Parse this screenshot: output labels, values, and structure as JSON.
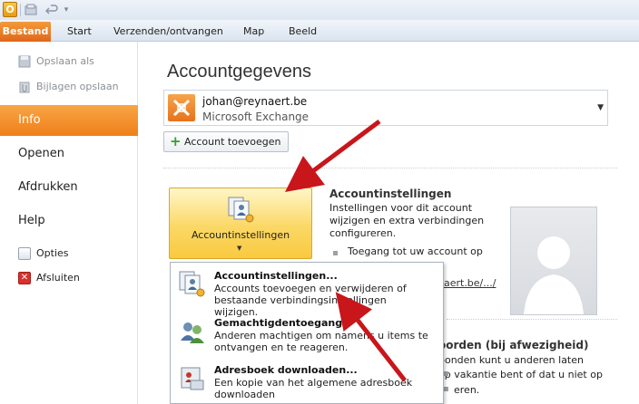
{
  "titlebar": {
    "app_letter": "O"
  },
  "ribbon": {
    "file_tab": "Bestand",
    "tabs": [
      "Start",
      "Verzenden/ontvangen",
      "Map",
      "Beeld"
    ]
  },
  "nav": {
    "save_as": "Opslaan als",
    "save_attachments": "Bijlagen opslaan",
    "info": "Info",
    "open": "Openen",
    "print": "Afdrukken",
    "help": "Help",
    "options": "Opties",
    "exit": "Afsluiten"
  },
  "main": {
    "title": "Accountgegevens",
    "account": {
      "email": "johan@reynaert.be",
      "type": "Microsoft Exchange"
    },
    "add_account": "Account toevoegen",
    "settings_button": "Accountinstellingen",
    "settings_section": {
      "title": "Accountinstellingen",
      "desc_lines": [
        "Instellingen voor dit account",
        "wijzigen en extra verbindingen",
        "configureren."
      ],
      "bullet": "Toegang tot uw account op",
      "link_partial": "naert.be/.../"
    },
    "ooo_section": {
      "title": "oorden (bij afwezigheid)",
      "line1": "bonden kunt u anderen laten",
      "line2": "op vakantie bent of dat u niet op",
      "line3": "eren."
    }
  },
  "menu": {
    "items": [
      {
        "title": "Accountinstellingen...",
        "desc1": "Accounts toevoegen en verwijderen of",
        "desc2": "bestaande verbindingsinstellingen wijzigen."
      },
      {
        "title": "Gemachtigdentoegang",
        "desc1": "Anderen machtigen om namens u items te",
        "desc2": "ontvangen en te reageren."
      },
      {
        "title": "Adresboek downloaden...",
        "desc1": "Een kopie van het algemene adresboek",
        "desc2": "downloaden"
      }
    ]
  },
  "colors": {
    "accent_orange": "#f29030",
    "button_yellow": "#fbd865",
    "arrow_red": "#c8161b"
  }
}
